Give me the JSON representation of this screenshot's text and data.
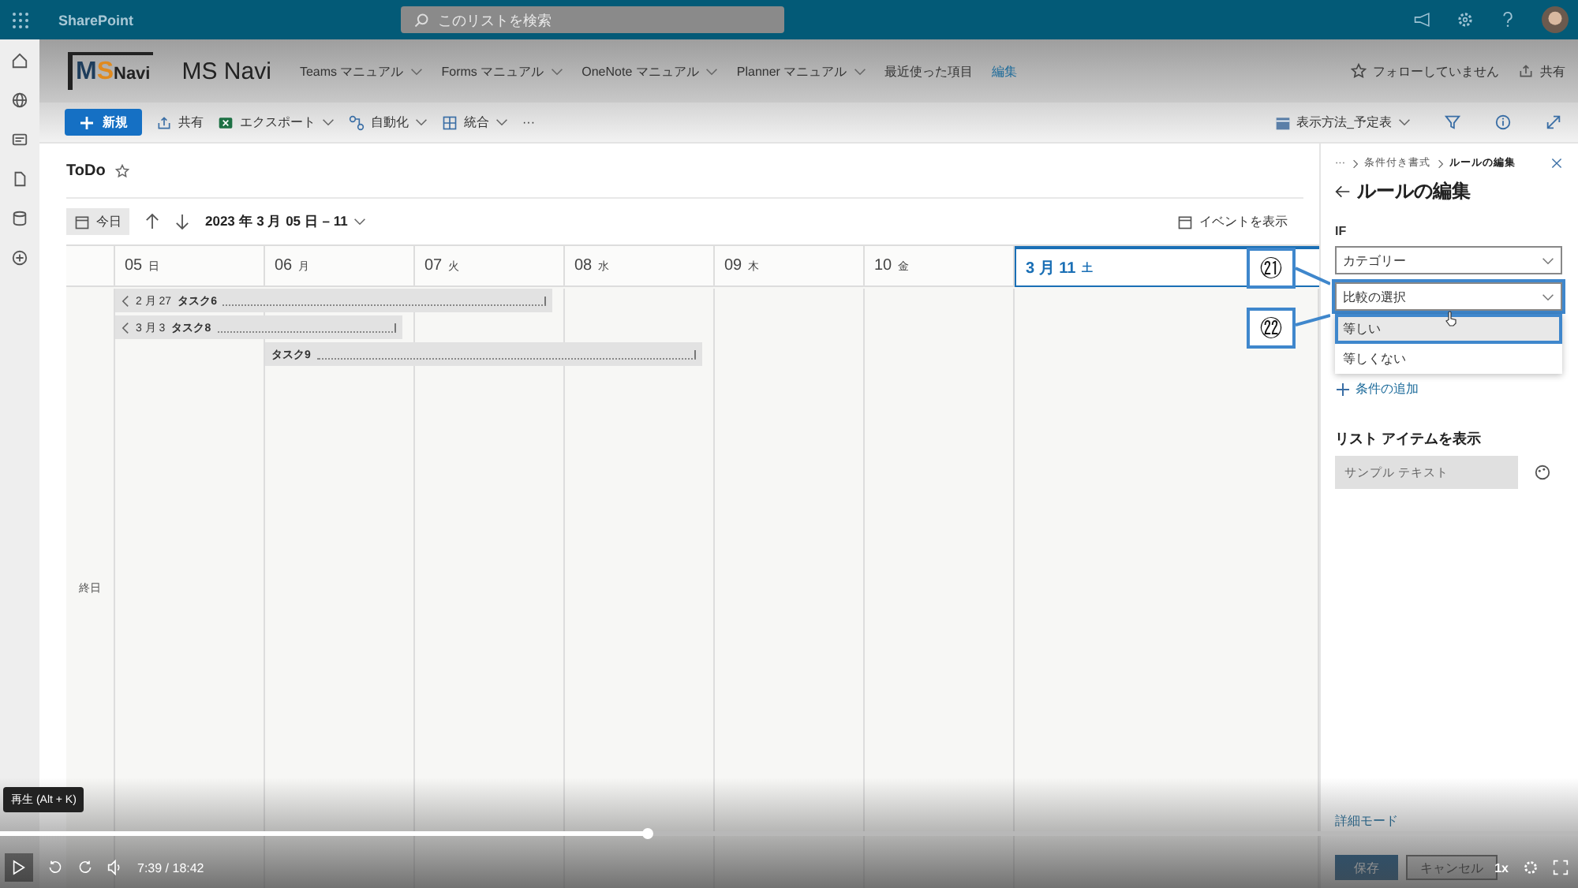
{
  "top_bar": {
    "app_name": "SharePoint",
    "search": {
      "placeholder": "このリストを検索"
    }
  },
  "site": {
    "logo": [
      {
        "text": "M",
        "kind": "dark"
      },
      {
        "text": "S",
        "kind": "accent"
      },
      {
        "text": "Navi",
        "kind": "dark"
      }
    ],
    "title": "MS Navi",
    "nav": [
      {
        "label": "Teams マニュアル",
        "dropdown": true
      },
      {
        "label": "Forms マニュアル",
        "dropdown": true
      },
      {
        "label": "OneNote マニュアル",
        "dropdown": true
      },
      {
        "label": "Planner マニュアル",
        "dropdown": true
      },
      {
        "label": "最近使った項目",
        "dropdown": false
      }
    ],
    "edit_link": "編集",
    "follow": "フォローしていません",
    "share": "共有"
  },
  "toolbar": {
    "new": "新規",
    "items": [
      {
        "label": "共有",
        "kind": "share",
        "dropdown": false
      },
      {
        "label": "エクスポート",
        "kind": "export",
        "dropdown": true
      },
      {
        "label": "自動化",
        "kind": "automate",
        "dropdown": true
      },
      {
        "label": "統合",
        "kind": "integrate",
        "dropdown": true
      }
    ],
    "more": "···",
    "view": "表示方法_予定表"
  },
  "list_title": "ToDo",
  "calendar": {
    "today": "今日",
    "range": "2023 年 3 月 05 日 – 11",
    "show_events": "イベントを表示",
    "all_day": "終日",
    "days": [
      {
        "date": "05",
        "dow": "日",
        "selected": false
      },
      {
        "date": "06",
        "dow": "月",
        "selected": false
      },
      {
        "date": "07",
        "dow": "火",
        "selected": false
      },
      {
        "date": "08",
        "dow": "水",
        "selected": false
      },
      {
        "date": "09",
        "dow": "木",
        "selected": false
      },
      {
        "date": "10",
        "dow": "金",
        "selected": false
      },
      {
        "date": "3 月 11",
        "dow": "土",
        "selected": true
      }
    ],
    "events": [
      {
        "from": "2 月 27",
        "title": "タスク6",
        "continues_before": true
      },
      {
        "from": "3 月 3",
        "title": "タスク8",
        "continues_before": true
      },
      {
        "title": "タスク9",
        "continues_before": false
      }
    ]
  },
  "panel": {
    "breadcrumb": [
      "···",
      "条件付き書式",
      "ルールの編集"
    ],
    "heading": "ルールの編集",
    "if_label": "IF",
    "field_value": "カテゴリー",
    "compare_placeholder": "比較の選択",
    "options": [
      {
        "label": "等しい",
        "selected": true
      },
      {
        "label": "等しくない",
        "selected": false
      }
    ],
    "add_condition": "条件の追加",
    "section": "リスト アイテムを表示",
    "sample": "サンプル テキスト",
    "advanced": "詳細モード",
    "save": "保存",
    "cancel": "キャンセル"
  },
  "annotations": [
    {
      "label": "㉑"
    },
    {
      "label": "㉒"
    }
  ],
  "player": {
    "tooltip": "再生 (Alt + K)",
    "time": "7:39 / 18:42",
    "speed": "1x",
    "level": 0.41
  }
}
